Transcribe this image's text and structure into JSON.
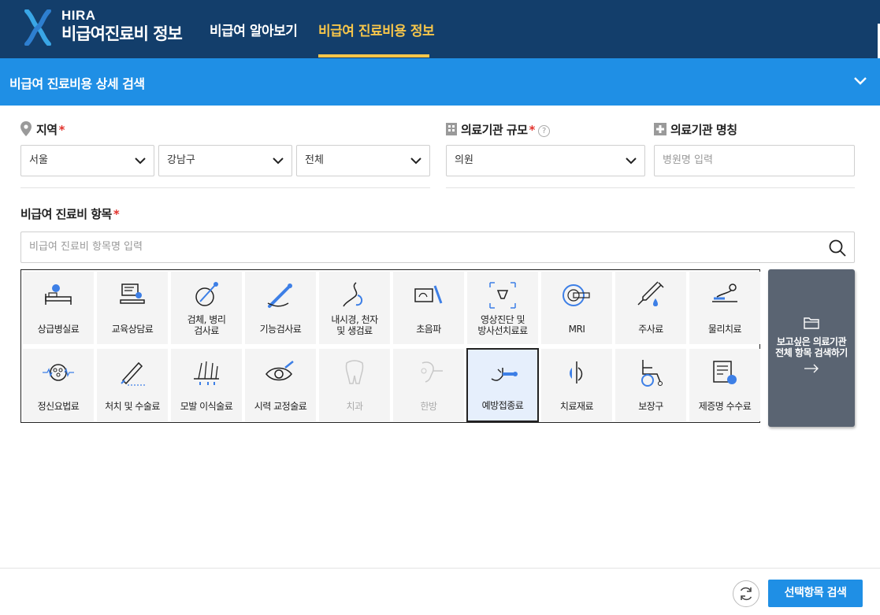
{
  "header": {
    "logo_brand": "HIRA",
    "logo_title": "비급여진료비 정보",
    "nav": [
      {
        "label": "비급여 알아보기",
        "active": false
      },
      {
        "label": "비급여 진료비용 정보",
        "active": true
      }
    ],
    "active_color": "#f7c64a",
    "bg_color": "#133e6b"
  },
  "panel": {
    "title": "비급여 진료비용 상세 검색",
    "bg_color": "#1f8fe5",
    "collapse_icon": "chevron-down-icon"
  },
  "region": {
    "label": "지역",
    "required_mark": "*",
    "icon": "location-pin-icon",
    "city": "서울",
    "district": "강남구",
    "dong": "전체"
  },
  "scale": {
    "label": "의료기관 규모",
    "required_mark": "*",
    "help": "?",
    "icon": "building-icon",
    "value": "의원"
  },
  "name": {
    "label": "의료기관 명칭",
    "icon": "hospital-cross-icon",
    "placeholder": "병원명 입력"
  },
  "items": {
    "label": "비급여 진료비 항목",
    "required_mark": "*",
    "placeholder": "비급여 진료비 항목명 입력",
    "tiles": [
      {
        "label": "상급병실료",
        "icon": "hospital-bed-icon",
        "state": "normal"
      },
      {
        "label": "교육상담료",
        "icon": "consultation-icon",
        "state": "normal"
      },
      {
        "label": "검체, 병리\n검사료",
        "icon": "specimen-test-icon",
        "state": "normal"
      },
      {
        "label": "기능검사료",
        "icon": "function-test-icon",
        "state": "normal"
      },
      {
        "label": "내시경, 천자\n및 생검료",
        "icon": "endoscope-icon",
        "state": "normal"
      },
      {
        "label": "초음파",
        "icon": "ultrasound-icon",
        "state": "normal"
      },
      {
        "label": "영상진단 및\n방사선치료료",
        "icon": "radiology-icon",
        "state": "normal"
      },
      {
        "label": "MRI",
        "icon": "mri-icon",
        "state": "normal"
      },
      {
        "label": "주사료",
        "icon": "syringe-icon",
        "state": "normal"
      },
      {
        "label": "물리치료",
        "icon": "physical-therapy-icon",
        "state": "normal"
      },
      {
        "label": "정신요법료",
        "icon": "brain-wave-icon",
        "state": "normal"
      },
      {
        "label": "처치 및 수술료",
        "icon": "surgery-icon",
        "state": "normal"
      },
      {
        "label": "모발 이식술료",
        "icon": "hair-transplant-icon",
        "state": "normal"
      },
      {
        "label": "시력 교정술료",
        "icon": "eye-correction-icon",
        "state": "normal"
      },
      {
        "label": "치과",
        "icon": "tooth-icon",
        "state": "disabled"
      },
      {
        "label": "한방",
        "icon": "oriental-medicine-icon",
        "state": "disabled"
      },
      {
        "label": "예방접종료",
        "icon": "vaccination-icon",
        "state": "selected"
      },
      {
        "label": "치료재료",
        "icon": "treatment-material-icon",
        "state": "normal"
      },
      {
        "label": "보장구",
        "icon": "wheelchair-icon",
        "state": "normal"
      },
      {
        "label": "제증명 수수료",
        "icon": "certificate-icon",
        "state": "normal"
      }
    ]
  },
  "all_search": {
    "text": "보고싶은 의료기관\n전체 항목 검색하기",
    "icon": "folder-icon",
    "arrow": "arrow-right-icon"
  },
  "footer": {
    "reset_icon": "refresh-icon",
    "search_label": "선택항목 검색"
  }
}
